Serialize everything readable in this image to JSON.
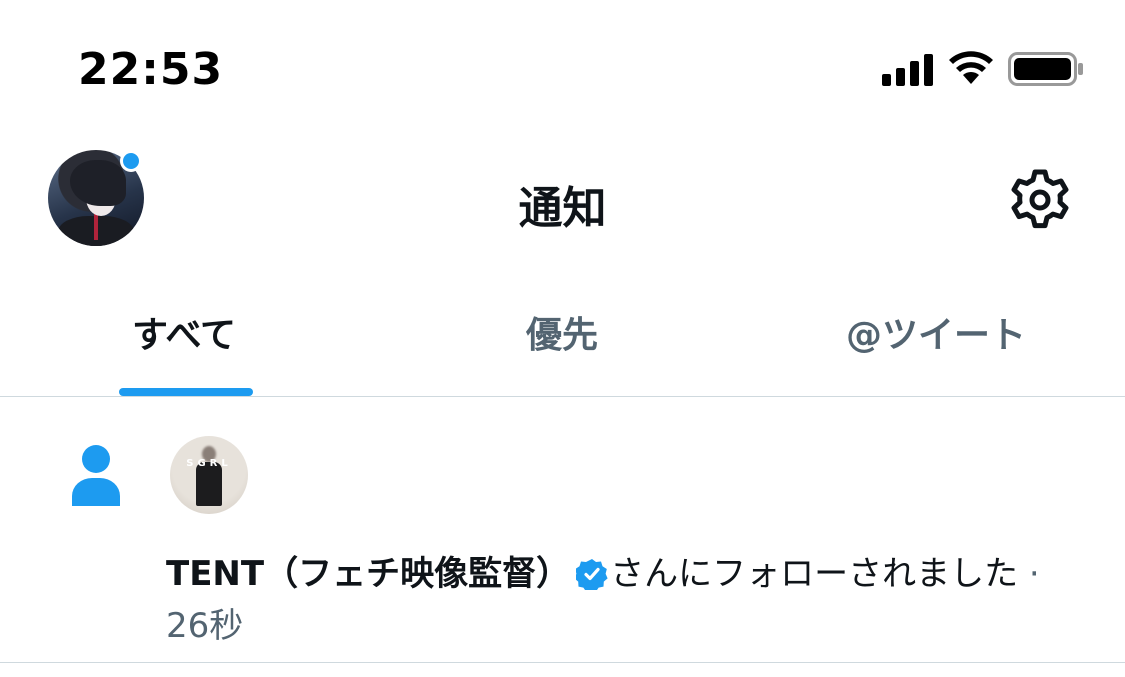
{
  "status_bar": {
    "time": "22:53"
  },
  "header": {
    "title": "通知"
  },
  "tabs": [
    {
      "label": "すべて",
      "active": true
    },
    {
      "label": "優先",
      "active": false
    },
    {
      "label": "@ツイート",
      "active": false
    }
  ],
  "notification": {
    "user_name": "TENT（フェチ映像監督）",
    "message": "さんにフォローされました",
    "separator": "·",
    "time": "26秒",
    "avatar_text": "SGRL"
  },
  "colors": {
    "accent": "#1d9bf0",
    "text": "#0f1419",
    "secondary_text": "#536471",
    "divider": "#cfd9de"
  },
  "icons": {
    "settings": "gear-icon",
    "follow": "person-icon",
    "verified": "verified-badge-icon"
  }
}
